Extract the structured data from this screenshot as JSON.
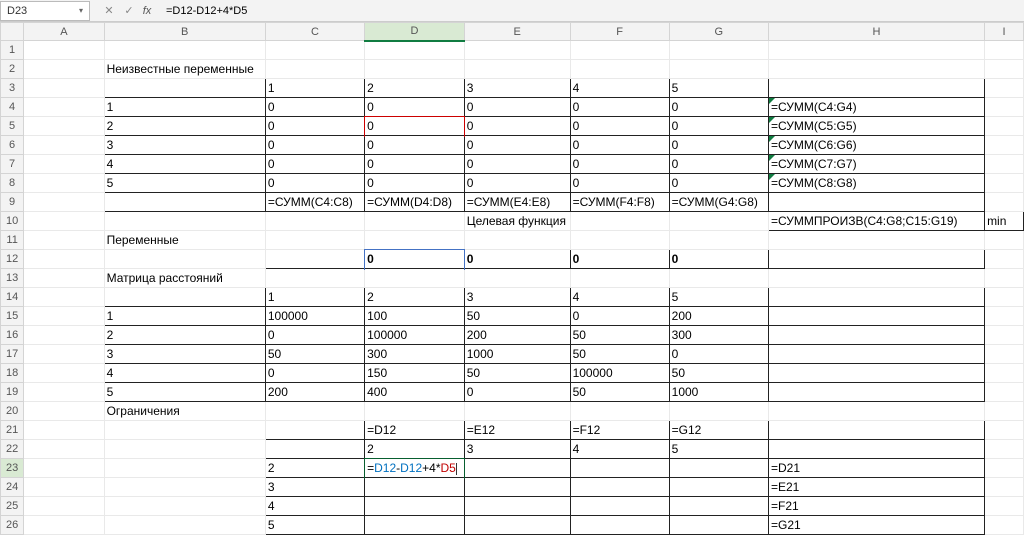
{
  "namebox": {
    "value": "D23"
  },
  "formula_bar": {
    "fx": "fx",
    "value": "=D12-D12+4*D5"
  },
  "columns": [
    "A",
    "B",
    "C",
    "D",
    "E",
    "F",
    "G",
    "H",
    "I"
  ],
  "rows": [
    1,
    2,
    3,
    4,
    5,
    6,
    7,
    8,
    9,
    10,
    11,
    12,
    13,
    14,
    15,
    16,
    17,
    18,
    19,
    20,
    21,
    22,
    23,
    24,
    25,
    26
  ],
  "labels": {
    "unknown_vars": "Неизвестные переменные",
    "variables": "Переменные",
    "objective": "Целевая функция",
    "dist_matrix": "Матрица расстояний",
    "constraints": "Ограничения",
    "min": "min"
  },
  "hdr_1_5": [
    "1",
    "2",
    "3",
    "4",
    "5"
  ],
  "zeros5": [
    "0",
    "0",
    "0",
    "0",
    "0"
  ],
  "sumCrow": [
    "=СУММ(C4:C8)",
    "=СУММ(D4:D8)",
    "=СУММ(E4:E8)",
    "=СУММ(F4:F8)",
    "=СУММ(G4:G8)"
  ],
  "sumH": [
    "=СУММ(C4:G4)",
    "=СУММ(C5:G5)",
    "=СУММ(C6:G6)",
    "=СУММ(C7:G7)",
    "=СУММ(C8:G8)"
  ],
  "sumprod": "=СУММПРОИЗВ(C4:G8;C15:G19)",
  "row12": [
    "0",
    "0",
    "0",
    "0"
  ],
  "dist": {
    "r1": [
      "100000",
      "100",
      "50",
      "0",
      "200"
    ],
    "r2": [
      "0",
      "100000",
      "200",
      "50",
      "300"
    ],
    "r3": [
      "50",
      "300",
      "1000",
      "50",
      "0"
    ],
    "r4": [
      "0",
      "150",
      "50",
      "100000",
      "50"
    ],
    "r5": [
      "200",
      "400",
      "0",
      "50",
      "1000"
    ]
  },
  "row21": [
    "=D12",
    "=E12",
    "=F12",
    "=G12"
  ],
  "row22": [
    "2",
    "3",
    "4",
    "5"
  ],
  "colC_22_26": [
    "2",
    "3",
    "4",
    "5"
  ],
  "colH_23_26": [
    "=D21",
    "=E21",
    "=F21",
    "=G21"
  ],
  "editing": {
    "tok1": "=",
    "tok2": "D12",
    "tok3": "-",
    "tok4": "D12",
    "tok5": "+4*",
    "tok6": "D5"
  }
}
